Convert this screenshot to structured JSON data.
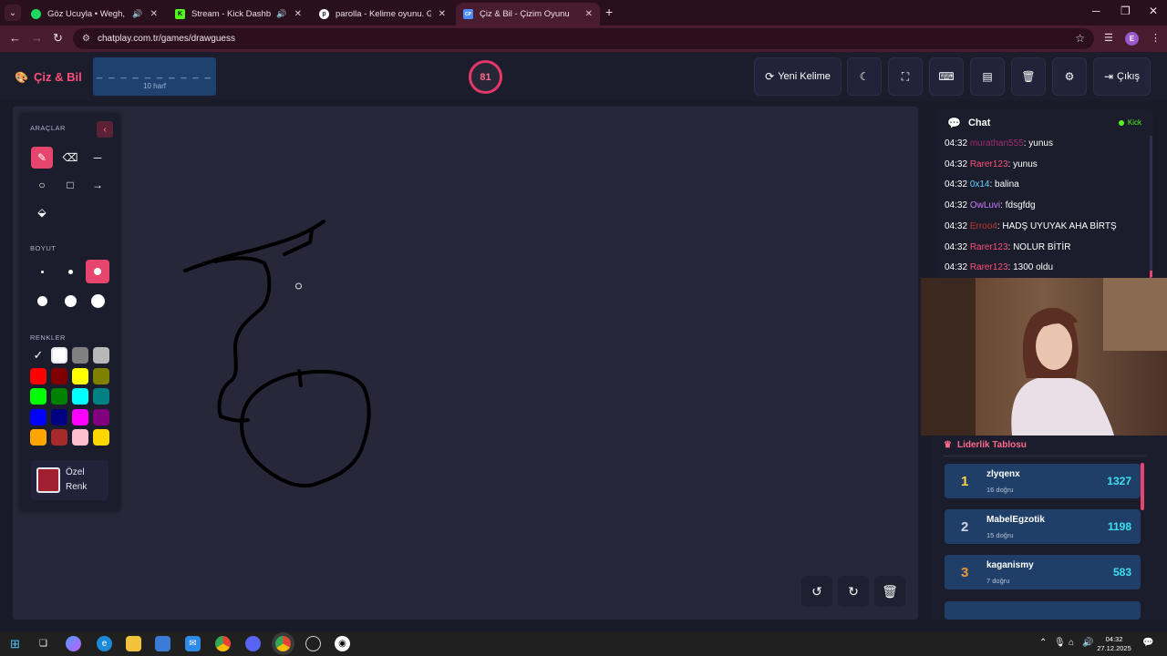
{
  "browser": {
    "tabs": [
      {
        "title": "Göz Ucuyla • Wegh, Reynmen",
        "favicon_color": "#1ed760"
      },
      {
        "title": "Stream - Kick Dashboard",
        "favicon_color": "#53fc18"
      },
      {
        "title": "parolla - Kelime oyunu. Günlük",
        "favicon_color": "#ffffff"
      },
      {
        "title": "Çiz & Bil - Çizim Oyunu",
        "favicon_color": "#4d8cff"
      }
    ],
    "url": "chatplay.com.tr/games/drawguess",
    "profile_initial": "E"
  },
  "header": {
    "logo": "Çiz & Bil",
    "word_mask": "_ _ _ _ _ _ _ _ _ _",
    "word_hint": "10 harf",
    "timer": "81",
    "new_word_label": "Yeni Kelime",
    "exit_label": "Çıkış"
  },
  "tools": {
    "section_tools": "ARAÇLAR",
    "section_size": "BOYUT",
    "section_colors": "RENKLER",
    "custom_color_label_1": "Özel",
    "custom_color_label_2": "Renk",
    "custom_color": "#a11f2e",
    "palette": [
      "#000000",
      "#ffffff",
      "#808080",
      "#b8b8b8",
      "#ff0000",
      "#800000",
      "#ffff00",
      "#808000",
      "#00ff00",
      "#008000",
      "#00ffff",
      "#008080",
      "#0000ff",
      "#000080",
      "#ff00ff",
      "#800080",
      "#ffa500",
      "#a52a2a",
      "#ffc0cb",
      "#ffd700"
    ],
    "active_tool": "brush",
    "active_size": 3
  },
  "chat": {
    "title": "Chat",
    "platform": "Kick",
    "messages": [
      {
        "time": "04:32",
        "user": "murathan555",
        "color": "#a0306a",
        "text": ": yunus"
      },
      {
        "time": "04:32",
        "user": "Rarer123",
        "color": "#ff4f7b",
        "text": ": yunus"
      },
      {
        "time": "04:32",
        "user": "0x14",
        "color": "#5fd3ff",
        "text": ": balina"
      },
      {
        "time": "04:32",
        "user": "OwLuvi",
        "color": "#c77dff",
        "text": ": fdsgfdg"
      },
      {
        "time": "04:32",
        "user": "Erroo4",
        "color": "#c0392b",
        "text": ": HADŞ UYUYAK AHA BİRTŞ"
      },
      {
        "time": "04:32",
        "user": "Rarer123",
        "color": "#ff4f7b",
        "text": ": NOLUR BİTİR"
      },
      {
        "time": "04:32",
        "user": "Rarer123",
        "color": "#ff4f7b",
        "text": ": 1300 oldu"
      }
    ]
  },
  "leaderboard": {
    "title": "Liderlik Tablosu",
    "rows": [
      {
        "rank": "1",
        "name": "zlyqenx",
        "correct": "16 doğru",
        "score": "1327",
        "rank_color": "#ffd23f"
      },
      {
        "rank": "2",
        "name": "MabelEgzotik",
        "correct": "15 doğru",
        "score": "1198",
        "rank_color": "#cfd8e6"
      },
      {
        "rank": "3",
        "name": "kaganismy",
        "correct": "7 doğru",
        "score": "583",
        "rank_color": "#e59a3a"
      }
    ]
  },
  "taskbar": {
    "time": "04:32",
    "date": "27.12.2025"
  }
}
